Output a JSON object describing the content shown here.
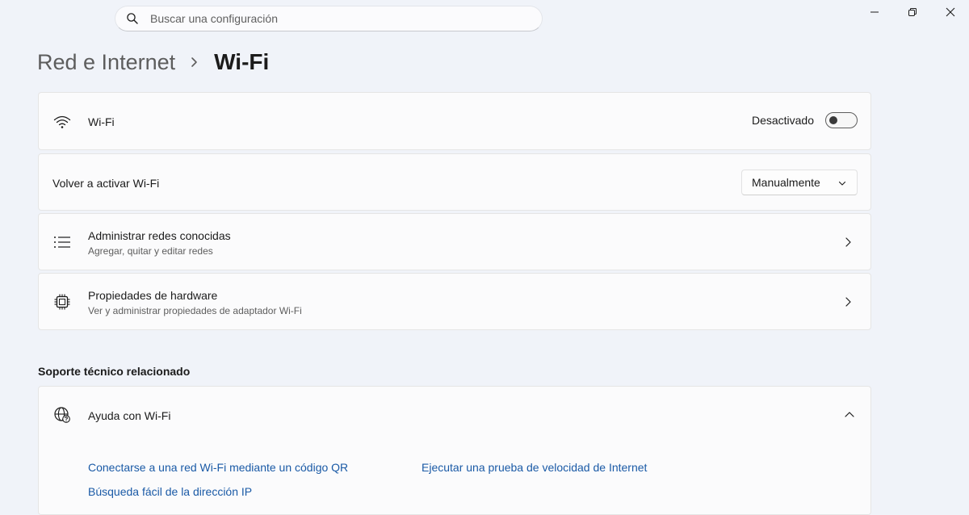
{
  "search": {
    "placeholder": "Buscar una configuración"
  },
  "breadcrumb": {
    "parent": "Red e Internet",
    "current": "Wi-Fi"
  },
  "wifi": {
    "label": "Wi-Fi",
    "status_label": "Desactivado",
    "enabled": false
  },
  "reactivate": {
    "label": "Volver a activar Wi-Fi",
    "selected_option": "Manualmente"
  },
  "known_networks": {
    "title": "Administrar redes conocidas",
    "subtitle": "Agregar, quitar y editar redes"
  },
  "hardware": {
    "title": "Propiedades de hardware",
    "subtitle": "Ver y administrar propiedades de adaptador Wi-Fi"
  },
  "support": {
    "section_title": "Soporte técnico relacionado",
    "help_title": "Ayuda con Wi-Fi",
    "links": [
      "Conectarse a una red Wi-Fi mediante un código QR",
      "Ejecutar una prueba de velocidad de Internet",
      "Búsqueda fácil de la dirección IP"
    ]
  },
  "colors": {
    "background": "#f0f3f9",
    "card": "#fbfbfc",
    "link": "#1a5aa6",
    "text": "#1b1b1b",
    "secondary_text": "#5d5d5d"
  },
  "icons": [
    "search-icon",
    "minimize-icon",
    "restore-icon",
    "close-icon",
    "chevron-right-icon",
    "wifi-icon",
    "chevron-down-icon",
    "list-icon",
    "chip-icon",
    "globe-help-icon",
    "chevron-up-icon"
  ]
}
